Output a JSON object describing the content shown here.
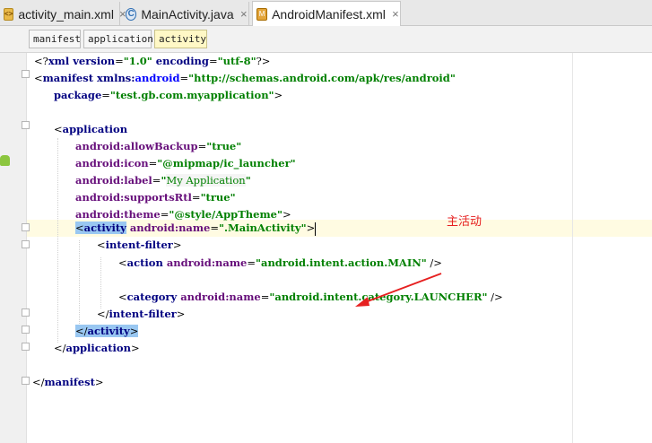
{
  "tabs": [
    {
      "label": "activity_main.xml",
      "icon": "xml-file-icon",
      "close": "×",
      "active": false
    },
    {
      "label": "MainActivity.java",
      "icon": "java-class-icon",
      "close": "×",
      "active": false
    },
    {
      "label": "AndroidManifest.xml",
      "icon": "manifest-file-icon",
      "close": "×",
      "active": true
    }
  ],
  "breadcrumb": [
    "manifest",
    "application",
    "activity"
  ],
  "code": {
    "l1_a": "<?",
    "l1_b": "xml version",
    "l1_c": "=",
    "l1_d": "\"1.0\"",
    "l1_e": " encoding",
    "l1_f": "=",
    "l1_g": "\"utf-8\"",
    "l1_h": "?>",
    "l2_a": "<",
    "l2_b": "manifest ",
    "l2_c": "xmlns:",
    "l2_d": "android",
    "l2_e": "=",
    "l2_f": "\"http://schemas.android.com/apk/res/android\"",
    "l3_a": "package",
    "l3_b": "=",
    "l3_c": "\"test.gb.com.myapplication\"",
    "l3_d": ">",
    "l5_a": "<",
    "l5_b": "application",
    "l6_ns": "android",
    "l6_attr": ":allowBackup",
    "l6_eq": "=",
    "l6_val": "\"true\"",
    "l7_ns": "android",
    "l7_attr": ":icon",
    "l7_eq": "=",
    "l7_val": "\"@mipmap/ic_launcher\"",
    "l8_ns": "android",
    "l8_attr": ":label",
    "l8_eq": "=",
    "l8_q1": "\"",
    "l8_val": "My Application",
    "l8_q2": "\"",
    "l9_ns": "android",
    "l9_attr": ":supportsRtl",
    "l9_eq": "=",
    "l9_val": "\"true\"",
    "l10_ns": "android",
    "l10_attr": ":theme",
    "l10_eq": "=",
    "l10_val": "\"@style/AppTheme\"",
    "l10_gt": ">",
    "l11_a": "<",
    "l11_b": "activity",
    "l11_c": " android",
    "l11_d": ":name",
    "l11_e": "=",
    "l11_f": "\".MainActivity\"",
    "l11_g": ">",
    "l12_a": "<",
    "l12_b": "intent-filter",
    "l12_c": ">",
    "l13_a": "<",
    "l13_b": "action ",
    "l13_c": "android",
    "l13_d": ":name",
    "l13_e": "=",
    "l13_f": "\"android.intent.action.MAIN\"",
    "l13_g": " />",
    "l15_a": "<",
    "l15_b": "category ",
    "l15_c": "android",
    "l15_d": ":name",
    "l15_e": "=",
    "l15_f": "\"android.intent.category.LAUNCHER\"",
    "l15_g": " />",
    "l16_a": "</",
    "l16_b": "intent-filter",
    "l16_c": ">",
    "l17_a": "</",
    "l17_b": "activity",
    "l17_c": ">",
    "l18_a": "</",
    "l18_b": "application",
    "l18_c": ">",
    "l20_a": "</",
    "l20_b": "manifest",
    "l20_c": ">"
  },
  "annotation": {
    "text": "主活动",
    "color": "#e62020"
  },
  "colors": {
    "tag": "#000080",
    "attribute": "#660e7a",
    "namespace": "#0000ff",
    "value": "#008000",
    "selection": "#99c7f1",
    "caret_line": "#fffbe2"
  }
}
